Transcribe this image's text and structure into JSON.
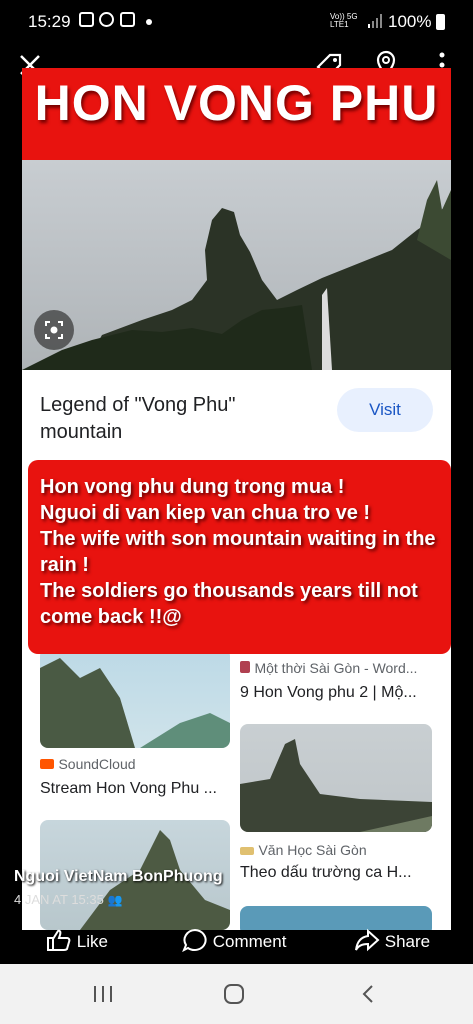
{
  "status": {
    "time": "15:29",
    "network_top": "Vo)) 5G",
    "network_bottom": "LTE1 ",
    "battery": "100%"
  },
  "viewer": {
    "close": "close-icon",
    "tag": "tag-icon",
    "location": "location-icon",
    "more": "more-icon"
  },
  "banner": {
    "title": "HON VONG PHU"
  },
  "result": {
    "title": "Legend of \"Vong Phu\" mountain",
    "visit_label": "Visit"
  },
  "caption_lines": [
    "Hon vong phu dung trong mua !",
    "Nguoi di van kiep van chua tro ve !",
    "The wife with son mountain waiting in the rain !",
    "The soldiers go thousands years till not come back !!@"
  ],
  "cards": [
    {
      "source": "SoundCloud",
      "title": "Stream Hon Vong Phu ..."
    },
    {
      "source": "Một thời Sài Gòn - Word...",
      "title": "9 Hon Vong phu 2 | Mộ..."
    },
    {
      "source": "Văn Học Sài Gòn",
      "title": "Theo dấu trường ca H..."
    }
  ],
  "post": {
    "author": "Nguoi VietNam BonPhuong",
    "date": "4 JAN AT 15:35"
  },
  "actions": {
    "like": "Like",
    "comment": "Comment",
    "share": "Share"
  },
  "colors": {
    "banner_red": "#e8130f",
    "visit_bg": "#e8f0fe",
    "visit_text": "#1a56c4"
  }
}
